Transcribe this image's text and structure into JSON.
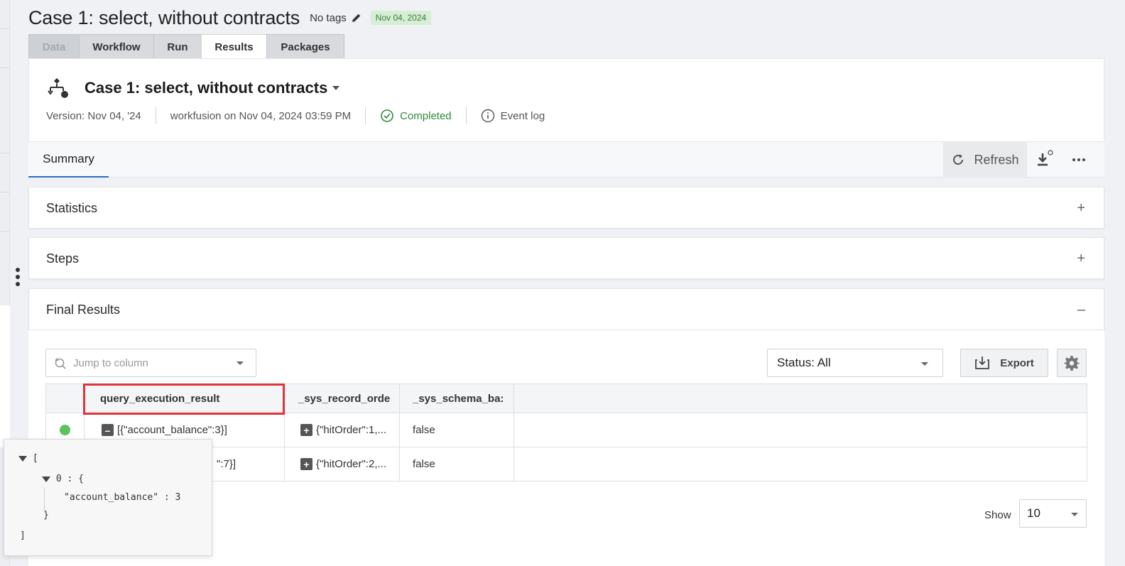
{
  "header": {
    "title": "Case 1: select, without contracts",
    "tags_label": "No tags",
    "date_badge": "Nov 04, 2024"
  },
  "tabs": [
    {
      "label": "Data",
      "state": "disabled"
    },
    {
      "label": "Workflow",
      "state": "normal"
    },
    {
      "label": "Run",
      "state": "normal"
    },
    {
      "label": "Results",
      "state": "active"
    },
    {
      "label": "Packages",
      "state": "normal"
    }
  ],
  "workflow": {
    "name": "Case 1: select, without contracts",
    "version": "Version: Nov 04, '24",
    "run_by": "workfusion on Nov 04, 2024 03:59 PM",
    "status": "Completed",
    "event_log": "Event log"
  },
  "summary_bar": {
    "tab": "Summary",
    "refresh_label": "Refresh"
  },
  "panels": {
    "statistics": {
      "title": "Statistics",
      "toggle": "+"
    },
    "steps": {
      "title": "Steps",
      "toggle": "+"
    },
    "final_results": {
      "title": "Final Results",
      "toggle": "–"
    }
  },
  "results": {
    "jump_placeholder": "Jump to column",
    "status_filter": "Status: All",
    "export_label": "Export",
    "columns": [
      "query_execution_result",
      "_sys_record_orde",
      "_sys_schema_ba:"
    ],
    "rows": [
      {
        "c1": "[{\"account_balance\":3}]",
        "c1_toggle": "–",
        "c2": "{\"hitOrder\":1,...",
        "c2_toggle": "+",
        "c3": "false"
      },
      {
        "c1": "\":7}]",
        "c1_toggle": "",
        "c2": "{\"hitOrder\":2,...",
        "c2_toggle": "+",
        "c3": "false"
      }
    ],
    "show_label": "Show",
    "page_size": "10"
  },
  "json_popup": {
    "open_bracket": "[",
    "item_key": "0 : {",
    "field": "\"account_balance\" : 3",
    "close_brace": "}",
    "close_bracket": "]"
  },
  "colors": {
    "accent": "#2c6fc2",
    "success": "#2e8b3d",
    "badge_bg": "#d6eed5",
    "highlight": "#e0333a",
    "status_dot": "#5cc15c"
  }
}
